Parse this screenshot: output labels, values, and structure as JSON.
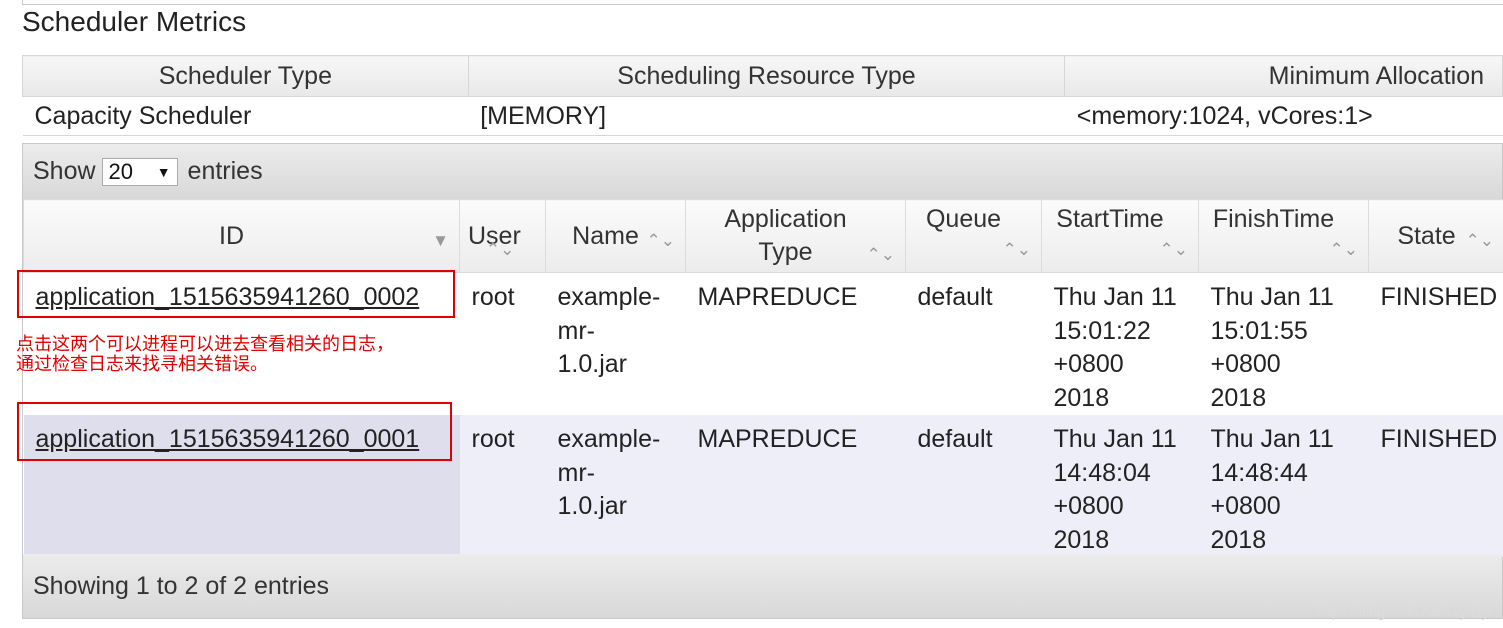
{
  "title": "Scheduler Metrics",
  "metrics": {
    "headers": [
      "Scheduler Type",
      "Scheduling Resource Type",
      "Minimum Allocation"
    ],
    "values": [
      "Capacity Scheduler",
      "[MEMORY]",
      "<memory:1024, vCores:1>"
    ]
  },
  "length_control": {
    "show_label": "Show",
    "selected": "20",
    "entries_label": "entries"
  },
  "columns": {
    "id": "ID",
    "user": "User",
    "name": "Name",
    "app_type_1": "Application",
    "app_type_2": "Type",
    "queue": "Queue",
    "start": "StartTime",
    "finish": "FinishTime",
    "state": "State"
  },
  "rows": [
    {
      "id": "application_1515635941260_0002",
      "user": "root",
      "name": [
        "example-",
        "mr-",
        "1.0.jar"
      ],
      "type": "MAPREDUCE",
      "queue": "default",
      "start": [
        "Thu Jan 11",
        "15:01:22",
        "+0800",
        "2018"
      ],
      "finish": [
        "Thu Jan 11",
        "15:01:55",
        "+0800",
        "2018"
      ],
      "state": "FINISHED"
    },
    {
      "id": "application_1515635941260_0001",
      "user": "root",
      "name": [
        "example-",
        "mr-",
        "1.0.jar"
      ],
      "type": "MAPREDUCE",
      "queue": "default",
      "start": [
        "Thu Jan 11",
        "14:48:04",
        "+0800",
        "2018"
      ],
      "finish": [
        "Thu Jan 11",
        "14:48:44",
        "+0800",
        "2018"
      ],
      "state": "FINISHED"
    }
  ],
  "info": "Showing 1 to 2 of 2 entries",
  "annotation": [
    "点击这两个可以进程可以进去查看相关的日志，",
    "通过检查日志来找寻相关错误。"
  ],
  "watermark": "https://blog.csdn.net/xxydzyr",
  "icons": {
    "sort_desc": "triangle-down",
    "sort_both": "up-down-chevrons"
  },
  "colors": {
    "annotation_red": "#e00000",
    "row_odd": "#ffffff",
    "row_even": "#eeeef9"
  }
}
